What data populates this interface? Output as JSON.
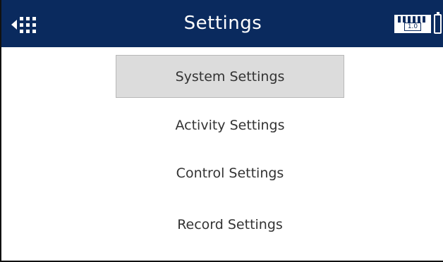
{
  "header": {
    "title": "Settings",
    "back_icon": "back-grid-icon",
    "meter_label": "1.0",
    "battery_icon": "battery-icon"
  },
  "menu": {
    "items": [
      {
        "label": "System Settings",
        "selected": true
      },
      {
        "label": "Activity Settings",
        "selected": false
      },
      {
        "label": "Control Settings",
        "selected": false
      },
      {
        "label": "Record Settings",
        "selected": false
      }
    ]
  },
  "colors": {
    "header_bg": "#0a2a5e",
    "selected_bg": "#dcdcdc",
    "text": "#333333"
  }
}
